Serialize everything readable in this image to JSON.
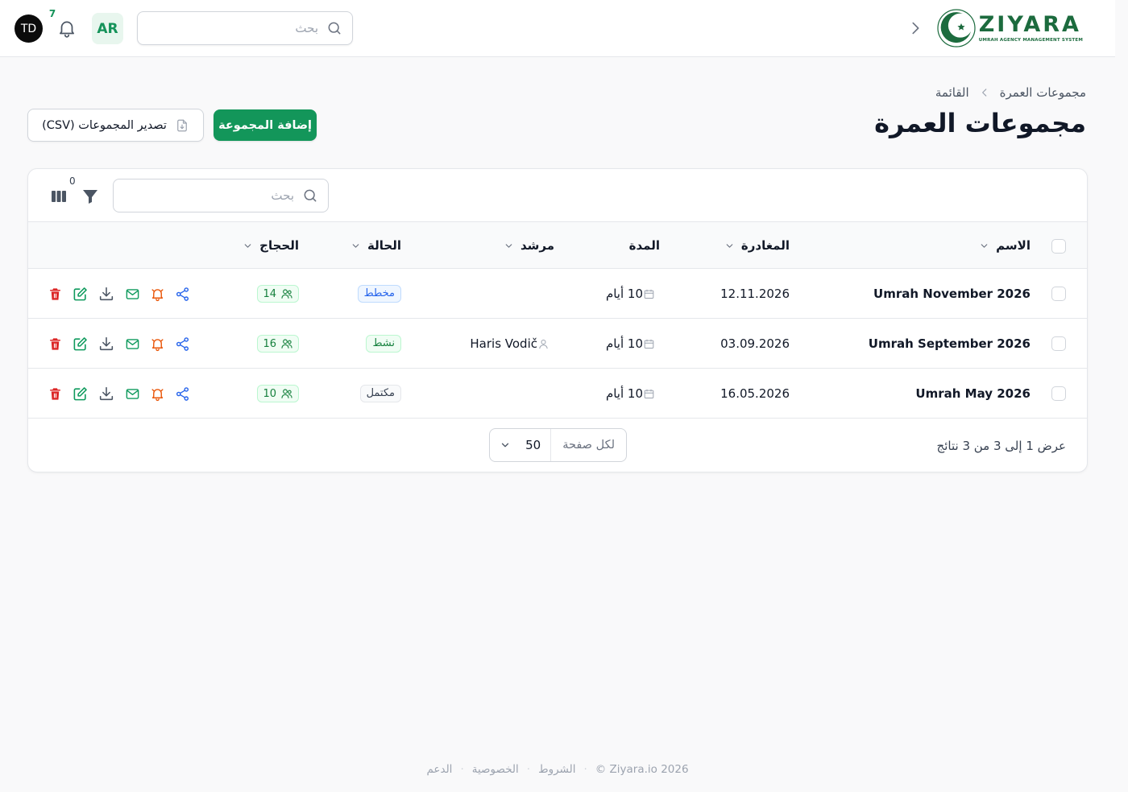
{
  "header": {
    "brand_name": "ZIYARA",
    "brand_tagline": "UMRAH AGENCY MANAGEMENT SYSTEM",
    "search_placeholder": "بحث",
    "language": "AR",
    "notification_count": "7",
    "user_initials": "TD"
  },
  "breadcrumb": {
    "parent": "مجموعات العمرة",
    "current": "القائمة"
  },
  "page": {
    "title": "مجموعات العمرة",
    "add_button": "إضافة المجموعة",
    "export_button": "تصدير المجموعات (CSV)"
  },
  "table": {
    "search_placeholder": "بحث",
    "filter_count": "0",
    "columns": {
      "name": "الاسم",
      "departure": "المغادرة",
      "duration": "المدة",
      "guide": "مرشد",
      "status": "الحالة",
      "pilgrims": "الحجاج"
    },
    "rows": [
      {
        "name": "Umrah November 2026",
        "departure": "12.11.2026",
        "duration": "10 أيام",
        "guide": "",
        "status": "مخطط",
        "status_kind": "planned",
        "pilgrims": "14"
      },
      {
        "name": "Umrah September 2026",
        "departure": "03.09.2026",
        "duration": "10 أيام",
        "guide": "Haris Vodič",
        "status": "نشط",
        "status_kind": "active",
        "pilgrims": "16"
      },
      {
        "name": "Umrah May 2026",
        "departure": "16.05.2026",
        "duration": "10 أيام",
        "guide": "",
        "status": "مكتمل",
        "status_kind": "done",
        "pilgrims": "10"
      }
    ],
    "results_text": "عرض 1 إلى 3 من 3 نتائج",
    "per_page_label": "لكل صفحة",
    "per_page_value": "50"
  },
  "footer": {
    "copyright": "© Ziyara.io 2026",
    "terms": "الشروط",
    "privacy": "الخصوصية",
    "support": "الدعم"
  },
  "colors": {
    "brand_green": "#13965a",
    "logo_green": "#1c6b3e",
    "delete_red": "#dc2626",
    "share_blue": "#2563eb",
    "bell_orange": "#ea580c"
  }
}
